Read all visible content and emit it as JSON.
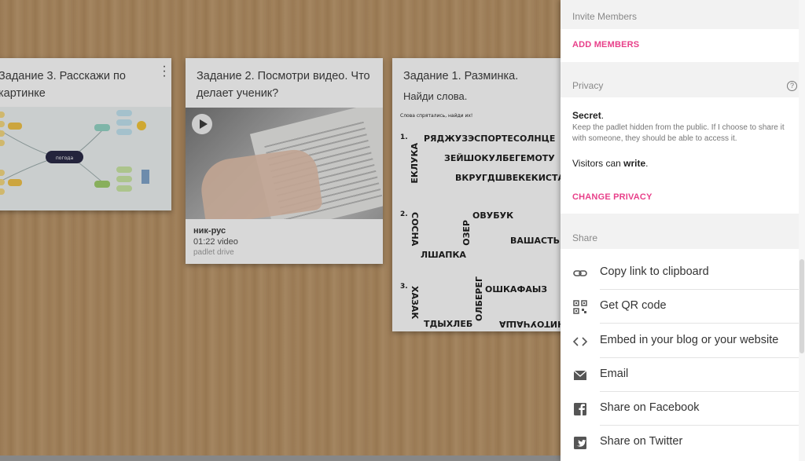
{
  "board": {
    "cards": [
      {
        "title": "Задание 3. Расскажи по картинке",
        "line1": "Задание 3. Расскажи по",
        "line2": "картинке",
        "image_center_label": "погода"
      },
      {
        "title": "Задание 2. Посмотри видео. Что делает ученик?",
        "video": {
          "name": "ник-рус",
          "length": "01:22 video",
          "source": "padlet drive"
        }
      },
      {
        "title": "Задание 1. Разминка.",
        "subtitle": "Найди слова.",
        "puzzle": {
          "intro": "Слова спрятались, найди их!",
          "n1": "1.",
          "n2": "2.",
          "n3": "3.",
          "r1a": "РЯДЖУЗЭСПОРТЕСОЛНЦЕ",
          "r1b": "ЗЕЙШОКУЛБЕГЕМОТУ",
          "r1c": "ВКРУГДШВЕКЕКИСТА",
          "v1": "ЕКЛУКА",
          "r2a": "ОВУБУК",
          "r2b": "ВАШАСТЬЁЛ",
          "r2c": "ЛШАПКА",
          "v2": "СОСНА",
          "v2b": "ОЗЕР",
          "r3a": "ОШКАФАЫЗ",
          "r3b": "ТДЫХЛЕБ",
          "r3c": "ЧИТОУЧАША",
          "v3": "ХАЗАК",
          "v3b": "ОЛБЕРЕГ"
        }
      }
    ]
  },
  "panel": {
    "invite_header": "Invite Members",
    "add_members": "ADD MEMBERS",
    "privacy_header": "Privacy",
    "help_glyph": "?",
    "privacy_level": "Secret",
    "privacy_desc": "Keep the padlet hidden from the public. If I choose to share it with someone, they should be able to access it.",
    "visitors_prefix": "Visitors can ",
    "visitors_permission": "write",
    "change_privacy": "CHANGE PRIVACY",
    "share_header": "Share",
    "share_items": [
      {
        "label": "Copy link to clipboard",
        "icon": "link-icon"
      },
      {
        "label": "Get QR code",
        "icon": "qr-code-icon"
      },
      {
        "label": "Embed in your blog or your website",
        "icon": "code-icon"
      },
      {
        "label": "Email",
        "icon": "email-icon"
      },
      {
        "label": "Share on Facebook",
        "icon": "facebook-icon"
      },
      {
        "label": "Share on Twitter",
        "icon": "twitter-icon"
      }
    ],
    "colors": {
      "accent": "#e8408a",
      "header_bg": "#f2f2f2"
    }
  }
}
